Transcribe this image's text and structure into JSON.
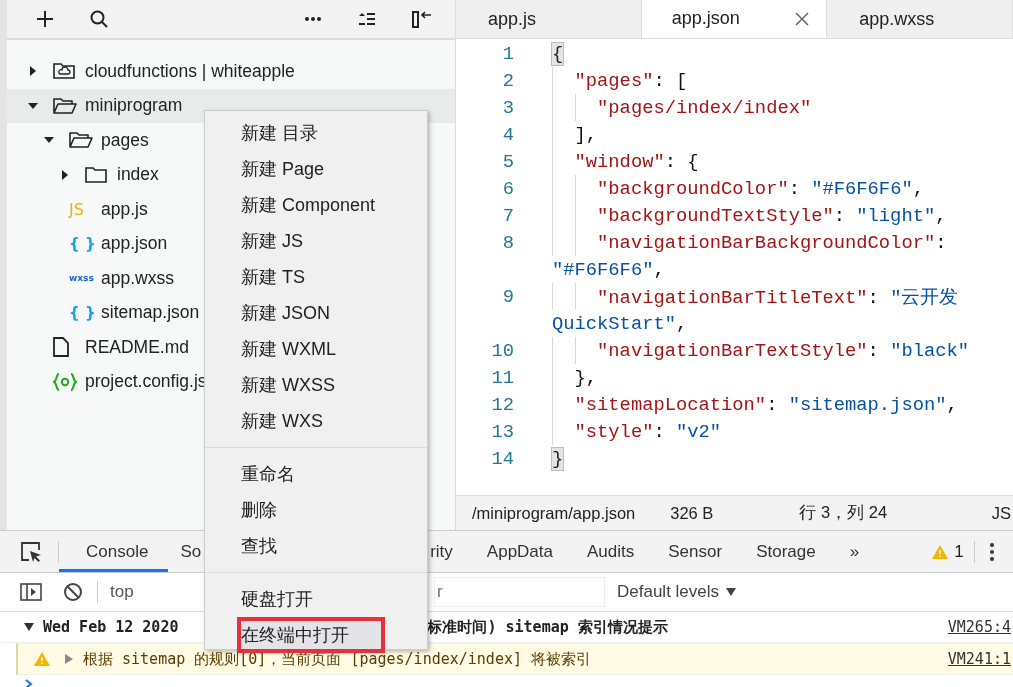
{
  "tree": [
    {
      "name": "cloudfunctions | whiteapple",
      "kind": "cloud-folder",
      "expanded": false,
      "selected": false
    },
    {
      "name": "miniprogram",
      "kind": "folder",
      "expanded": true,
      "selected": true,
      "children": [
        {
          "name": "pages",
          "kind": "folder",
          "expanded": true,
          "selected": false,
          "children": [
            {
              "name": "index",
              "kind": "folder",
              "expanded": false,
              "selected": false
            }
          ]
        },
        {
          "name": "app.js",
          "kind": "js",
          "icon_text": "JS",
          "selected": false
        },
        {
          "name": "app.json",
          "kind": "json",
          "icon_text": "{ }",
          "selected": false
        },
        {
          "name": "app.wxss",
          "kind": "wxss",
          "icon_text": "wxss",
          "selected": false
        },
        {
          "name": "sitemap.json",
          "kind": "json",
          "icon_text": "{ }",
          "selected": false
        }
      ]
    },
    {
      "name": "README.md",
      "kind": "file",
      "selected": false
    },
    {
      "name": "project.config.js",
      "kind": "config",
      "selected": false
    }
  ],
  "context_menu": {
    "groups": [
      [
        {
          "label": "新建 目录",
          "selected": false
        },
        {
          "label": "新建 Page",
          "selected": false
        },
        {
          "label": "新建 Component",
          "selected": false
        },
        {
          "label": "新建 JS",
          "selected": false
        },
        {
          "label": "新建 TS",
          "selected": false
        },
        {
          "label": "新建 JSON",
          "selected": false
        },
        {
          "label": "新建 WXML",
          "selected": false
        },
        {
          "label": "新建 WXSS",
          "selected": false
        },
        {
          "label": "新建 WXS",
          "selected": false
        }
      ],
      [
        {
          "label": "重命名",
          "selected": false
        },
        {
          "label": "删除",
          "selected": false
        },
        {
          "label": "查找",
          "selected": false
        }
      ],
      [
        {
          "label": "硬盘打开",
          "selected": false
        },
        {
          "label": "在终端中打开",
          "selected": true
        }
      ]
    ]
  },
  "editor": {
    "tabs": [
      {
        "label": "app.js",
        "selected": false
      },
      {
        "label": "app.json",
        "selected": true
      },
      {
        "label": "app.wxss",
        "selected": false
      }
    ],
    "lines": [
      {
        "number": "1",
        "kind": "line",
        "tokens": [
          {
            "text": "{",
            "kind": "match"
          }
        ],
        "children": [
          {
            "number": "2",
            "kind": "line",
            "tokens": [
              {
                "text": "\"pages\"",
                "kind": "key"
              },
              {
                "text": ": [",
                "kind": "punct"
              }
            ],
            "children": [
              {
                "number": "3",
                "kind": "line",
                "tokens": [
                  {
                    "text": "\"pages/index/index\"",
                    "kind": "key"
                  }
                ]
              }
            ]
          },
          {
            "number": "4",
            "kind": "line",
            "tokens": [
              {
                "text": "],",
                "kind": "punct"
              }
            ]
          },
          {
            "number": "5",
            "kind": "line",
            "tokens": [
              {
                "text": "\"window\"",
                "kind": "key"
              },
              {
                "text": ": {",
                "kind": "punct"
              }
            ],
            "children": [
              {
                "number": "6",
                "kind": "line",
                "tokens": [
                  {
                    "text": "\"backgroundColor\"",
                    "kind": "key"
                  },
                  {
                    "text": ": ",
                    "kind": "punct"
                  },
                  {
                    "text": "\"#F6F6F6\"",
                    "kind": "string"
                  },
                  {
                    "text": ",",
                    "kind": "punct"
                  }
                ]
              },
              {
                "number": "7",
                "kind": "line",
                "tokens": [
                  {
                    "text": "\"backgroundTextStyle\"",
                    "kind": "key"
                  },
                  {
                    "text": ": ",
                    "kind": "punct"
                  },
                  {
                    "text": "\"light\"",
                    "kind": "string"
                  },
                  {
                    "text": ",",
                    "kind": "punct"
                  }
                ]
              },
              {
                "number": "8",
                "kind": "line",
                "tokens": [
                  {
                    "text": "\"navigationBarBackgroundColor\"",
                    "kind": "key"
                  },
                  {
                    "text": ":",
                    "kind": "punct"
                  }
                ]
              },
              {
                "kind": "wrap",
                "tokens": [
                  {
                    "text": "\"#F6F6F6\"",
                    "kind": "string"
                  },
                  {
                    "text": ",",
                    "kind": "punct"
                  }
                ]
              },
              {
                "number": "9",
                "kind": "line",
                "tokens": [
                  {
                    "text": "\"navigationBarTitleText\"",
                    "kind": "key"
                  },
                  {
                    "text": ": ",
                    "kind": "punct"
                  },
                  {
                    "text": "\"云开发",
                    "kind": "string"
                  }
                ]
              },
              {
                "kind": "wrap",
                "tokens": [
                  {
                    "text": "QuickStart\"",
                    "kind": "string"
                  },
                  {
                    "text": ",",
                    "kind": "punct"
                  }
                ]
              },
              {
                "number": "10",
                "kind": "line",
                "tokens": [
                  {
                    "text": "\"navigationBarTextStyle\"",
                    "kind": "key"
                  },
                  {
                    "text": ": ",
                    "kind": "punct"
                  },
                  {
                    "text": "\"black\"",
                    "kind": "string"
                  }
                ]
              }
            ]
          },
          {
            "number": "11",
            "kind": "line",
            "tokens": [
              {
                "text": "},",
                "kind": "punct"
              }
            ]
          },
          {
            "number": "12",
            "kind": "line",
            "tokens": [
              {
                "text": "\"sitemapLocation\"",
                "kind": "key"
              },
              {
                "text": ": ",
                "kind": "punct"
              },
              {
                "text": "\"sitemap.json\"",
                "kind": "string"
              },
              {
                "text": ",",
                "kind": "punct"
              }
            ]
          },
          {
            "number": "13",
            "kind": "line",
            "tokens": [
              {
                "text": "\"style\"",
                "kind": "key"
              },
              {
                "text": ": ",
                "kind": "punct"
              },
              {
                "text": "\"v2\"",
                "kind": "string"
              }
            ]
          }
        ]
      },
      {
        "number": "14",
        "kind": "line",
        "tokens": [
          {
            "text": "}",
            "kind": "match"
          }
        ]
      }
    ]
  },
  "status_bar": {
    "path": "/miniprogram/app.json",
    "size": "326 B",
    "position": "行 3，列 24",
    "language": "JS"
  },
  "devtools": {
    "tabs": [
      {
        "label": "Console",
        "selected": true
      },
      {
        "label": "So",
        "selected": false
      },
      {
        "label": "rity",
        "selected": false
      },
      {
        "label": "AppData",
        "selected": false
      },
      {
        "label": "Audits",
        "selected": false
      },
      {
        "label": "Sensor",
        "selected": false
      },
      {
        "label": "Storage",
        "selected": false
      }
    ],
    "overflow": "»",
    "warning_count": "1",
    "context": "top",
    "filter": "r",
    "levels": "Default levels"
  },
  "console": [
    {
      "kind": "group",
      "expanded": true,
      "parts": [
        "Wed Feb 12 2020",
        "标准时间) sitemap 索引情况提示"
      ],
      "source": "VM265:4"
    },
    {
      "kind": "warning",
      "expanded": false,
      "parts": [
        "根据 sitemap 的规则[0]，当前页面 [pages/index/index] 将被索引"
      ],
      "source": "VM241:1"
    }
  ]
}
